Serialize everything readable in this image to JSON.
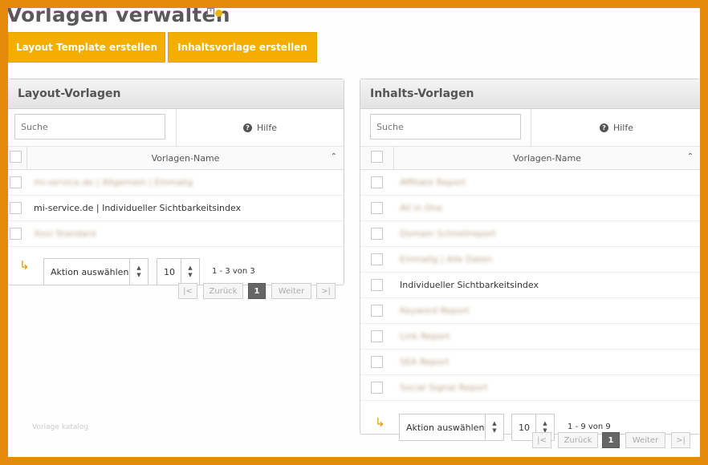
{
  "page": {
    "title": "Vorlagen verwalten",
    "watermark": "Vorlage katalog"
  },
  "actions": {
    "create_layout": "Layout Template erstellen",
    "create_content": "Inhaltsvorlage erstellen"
  },
  "colors": {
    "frame": "#e58a0a",
    "accent": "#f3ae00"
  },
  "layout_panel": {
    "title": "Layout-Vorlagen",
    "search_placeholder": "Suche",
    "help_label": "Hilfe",
    "column_header": "Vorlagen-Name",
    "rows": [
      {
        "name": "mi-service.de | Allgemein | Einmalig",
        "blurred": true
      },
      {
        "name": "mi-service.de | Individueller Sichtbarkeitsindex",
        "blurred": false
      },
      {
        "name": "Xovi Standard",
        "blurred": true
      }
    ],
    "bulk_action": "Aktion auswählen",
    "page_size": "10",
    "range": "1 - 3 von 3",
    "pagination": {
      "first": "|<",
      "prev": "Zurück",
      "current": "1",
      "next": "Weiter",
      "last": ">|"
    }
  },
  "content_panel": {
    "title": "Inhalts-Vorlagen",
    "search_placeholder": "Suche",
    "help_label": "Hilfe",
    "column_header": "Vorlagen-Name",
    "rows": [
      {
        "name": "Affiliate Report",
        "blurred": true
      },
      {
        "name": "All in One",
        "blurred": true
      },
      {
        "name": "Domain Schnellreport",
        "blurred": true
      },
      {
        "name": "Einmalig | Alle Daten",
        "blurred": true
      },
      {
        "name": "Individueller Sichtbarkeitsindex",
        "blurred": false
      },
      {
        "name": "Keyword Report",
        "blurred": true
      },
      {
        "name": "Link Report",
        "blurred": true
      },
      {
        "name": "SEA Report",
        "blurred": true
      },
      {
        "name": "Social Signal Report",
        "blurred": true
      }
    ],
    "bulk_action": "Aktion auswählen",
    "page_size": "10",
    "range": "1 - 9 von 9",
    "pagination": {
      "first": "|<",
      "prev": "Zurück",
      "current": "1",
      "next": "Weiter",
      "last": ">|"
    }
  }
}
